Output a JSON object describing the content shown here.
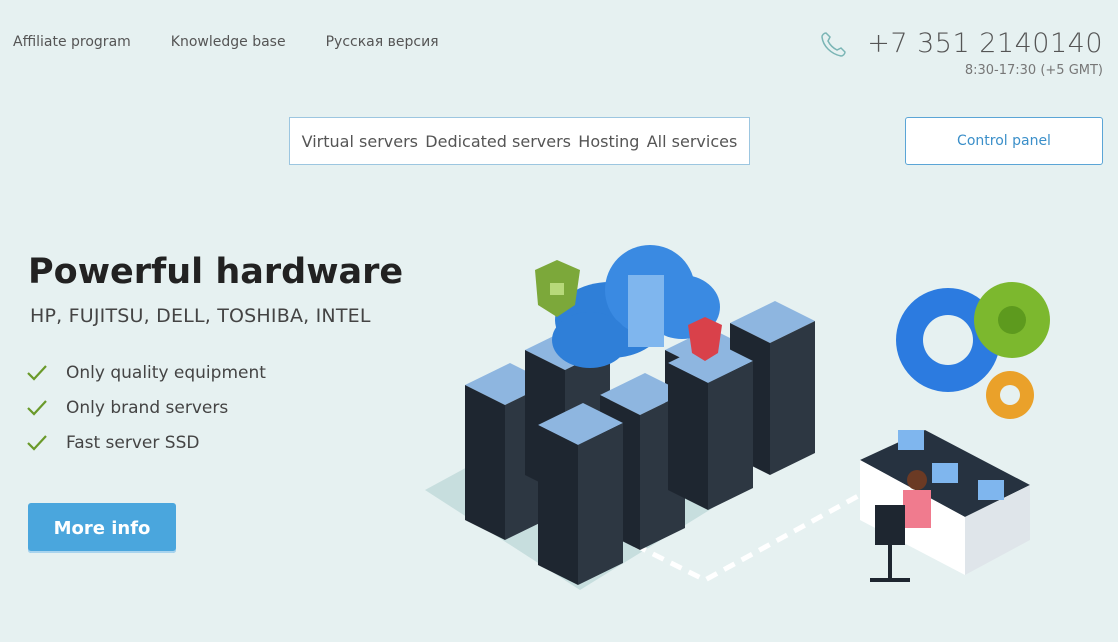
{
  "top_links": [
    "Affiliate program",
    "Knowledge base",
    "Русская версия"
  ],
  "contact": {
    "phone": "+7 351 2140140",
    "hours": "8:30-17:30 (+5 GMT)"
  },
  "nav": [
    "Virtual servers",
    "Dedicated servers",
    "Hosting",
    "All services"
  ],
  "control_panel_label": "Control panel",
  "hero": {
    "title": "Powerful hardware",
    "subtitle": "HP, FUJITSU, DELL, TOSHIBA, INTEL",
    "features": [
      "Only quality equipment",
      "Only brand servers",
      "Fast server SSD"
    ],
    "cta_label": "More info"
  },
  "colors": {
    "background": "#e6f1f1",
    "accent": "#4aa6dd",
    "check": "#6a9a2a"
  },
  "icons": [
    "phone-icon",
    "check-icon"
  ]
}
